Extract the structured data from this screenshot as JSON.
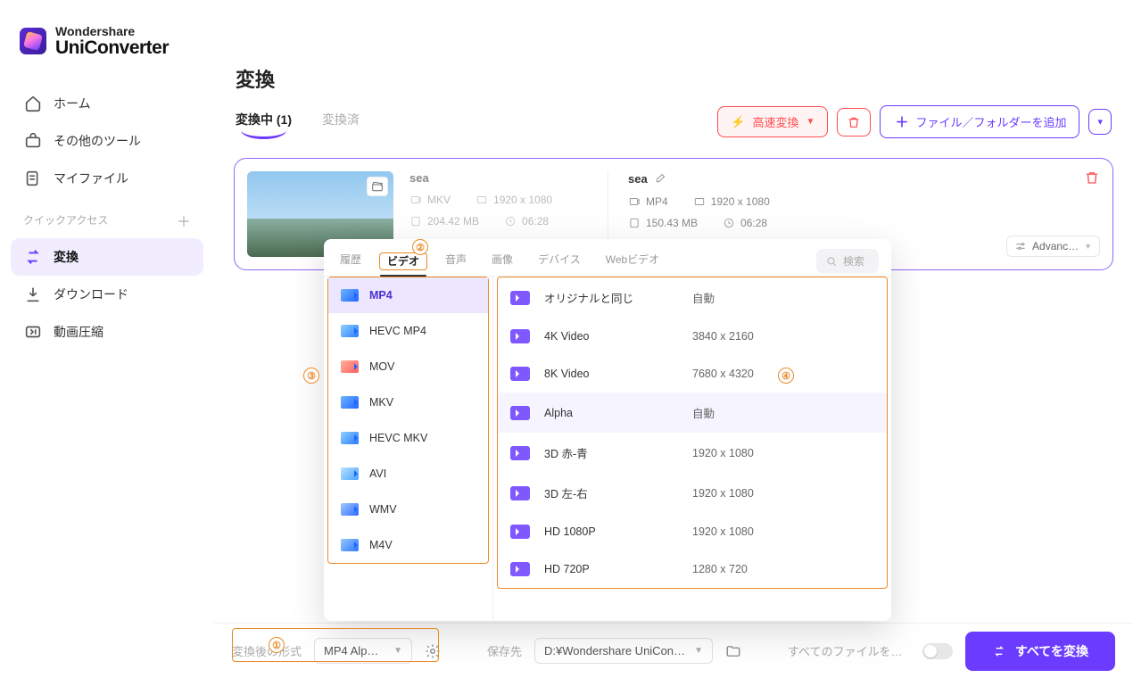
{
  "brand": {
    "line1": "Wondershare",
    "line2": "UniConverter"
  },
  "sidebar": {
    "home": "ホーム",
    "other_tools": "その他のツール",
    "my_files": "マイファイル",
    "quick_access": "クイックアクセス",
    "items": [
      {
        "label": "変換"
      },
      {
        "label": "ダウンロード"
      },
      {
        "label": "動画圧縮"
      }
    ]
  },
  "header": {
    "title": "変換",
    "tabs": {
      "converting": "変換中",
      "count": "(1)",
      "converted": "変換済"
    },
    "speed": "高速変換",
    "add_file": "ファイル／フォルダーを追加"
  },
  "file": {
    "src": {
      "name": "sea",
      "format": "MKV",
      "resolution": "1920 x 1080",
      "size": "204.42 MB",
      "duration": "06:28"
    },
    "dst": {
      "name": "sea",
      "format": "MP4",
      "resolution": "1920 x 1080",
      "size": "150.43 MB",
      "duration": "06:28"
    },
    "advance": "Advanc…"
  },
  "popover": {
    "tabs": {
      "history": "履歴",
      "video": "ビデオ",
      "audio": "音声",
      "image": "画像",
      "device": "デバイス",
      "web": "Webビデオ"
    },
    "search_placeholder": "検索",
    "formats": [
      "MP4",
      "HEVC MP4",
      "MOV",
      "MKV",
      "HEVC MKV",
      "AVI",
      "WMV",
      "M4V"
    ],
    "resolutions": [
      {
        "label": "オリジナルと同じ",
        "dim": "自動"
      },
      {
        "label": "4K Video",
        "dim": "3840 x 2160"
      },
      {
        "label": "8K Video",
        "dim": "7680 x 4320"
      },
      {
        "label": "Alpha",
        "dim": "自動"
      },
      {
        "label": "3D 赤-青",
        "dim": "1920 x 1080"
      },
      {
        "label": "3D 左-右",
        "dim": "1920 x 1080"
      },
      {
        "label": "HD 1080P",
        "dim": "1920 x 1080"
      },
      {
        "label": "HD 720P",
        "dim": "1280 x 720"
      }
    ]
  },
  "bottom": {
    "output_format_label": "変換後の形式",
    "output_format_value": "MP4 Alp…",
    "save_to_label": "保存先",
    "save_to_value": "D:¥Wondershare UniCon…",
    "merge_label": "すべてのファイルを…",
    "convert_all": "すべてを変換"
  },
  "callouts": {
    "c1": "①",
    "c2": "②",
    "c3": "③",
    "c4": "④"
  }
}
